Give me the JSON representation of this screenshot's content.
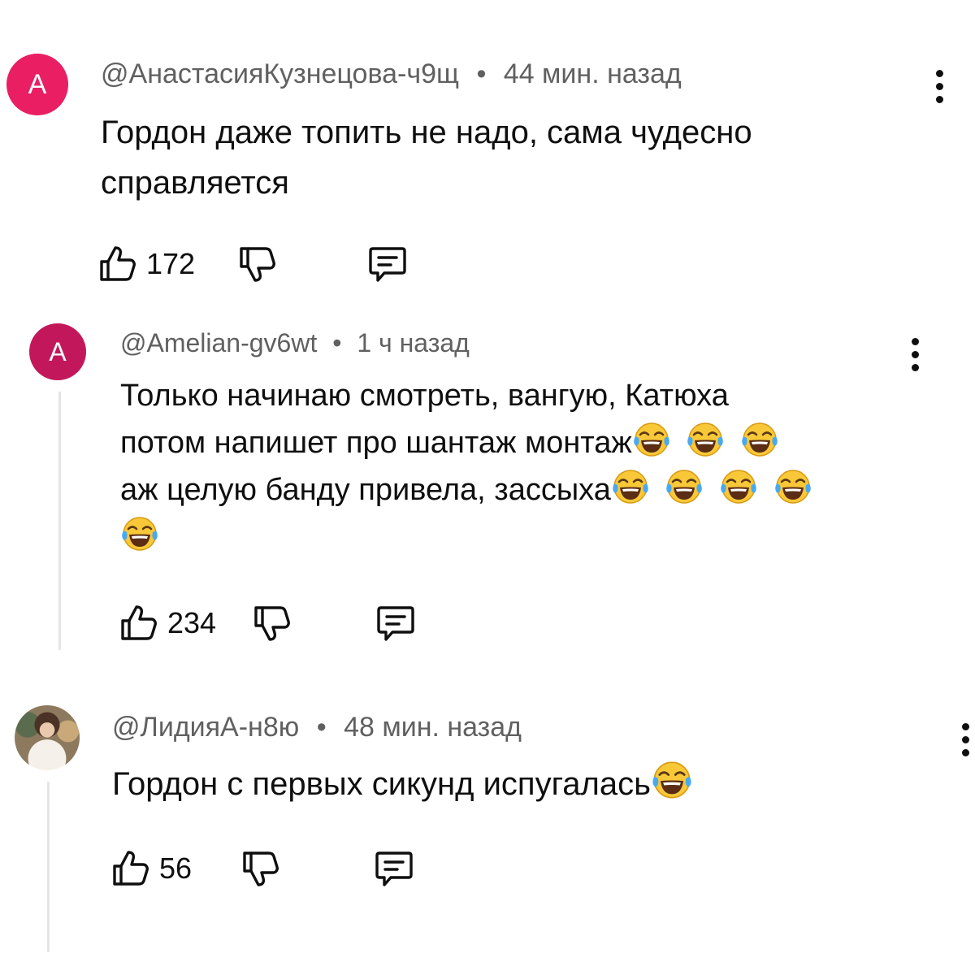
{
  "comments": [
    {
      "avatar_letter": "A",
      "author": "@АнастасияКузнецова-ч9щ",
      "time": "44 мин. назад",
      "text_lines": [
        "Гордон даже топить не надо, сама чудесно",
        "справляется"
      ],
      "likes": "172"
    },
    {
      "avatar_letter": "A",
      "author": "@Amelian-gv6wt",
      "time": "1 ч назад",
      "text_lines": [
        "Только начинаю смотреть, вангую, Катюха",
        "потом напишет про шантаж монтаж",
        "аж целую банду привела, зассыха"
      ],
      "likes": "234"
    },
    {
      "author": "@ЛидияА-н8ю",
      "time": "48 мин. назад",
      "text_lines": [
        "Гордон с первых сикунд испугалась"
      ],
      "likes": "56"
    }
  ],
  "separator": "•",
  "icons": {
    "like": "thumbs-up-icon",
    "dislike": "thumbs-down-icon",
    "reply": "reply-comment-icon",
    "more": "more-vert-icon",
    "emoji": "tears-of-joy-emoji"
  },
  "colors": {
    "avatar_pink": "#e91e63",
    "avatar_crimson": "#c2185b",
    "meta_gray": "#606060",
    "thread_line": "#e5e5e5"
  }
}
